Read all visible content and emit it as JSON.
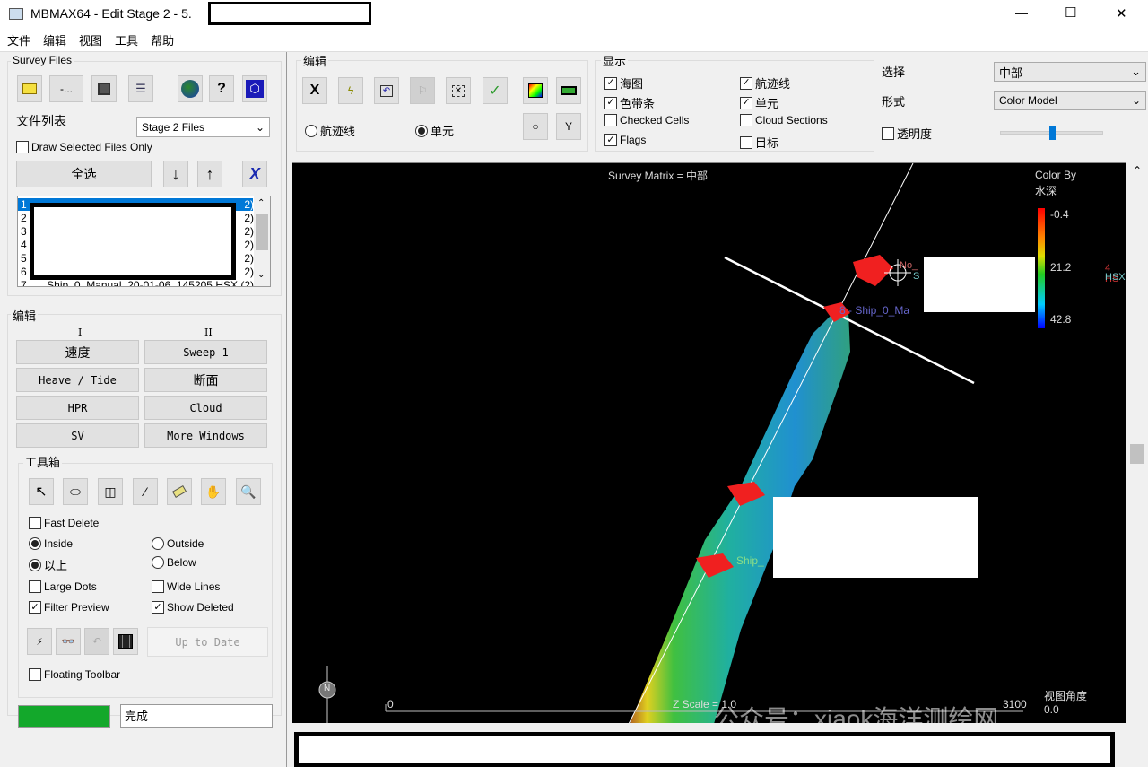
{
  "window": {
    "title": "MBMAX64 - Edit Stage 2 - 5.",
    "minimize": "—",
    "maximize": "☐",
    "close": "✕"
  },
  "menu": [
    "文件",
    "编辑",
    "视图",
    "工具",
    "帮助"
  ],
  "survey_files": {
    "label": "Survey Files",
    "list_label": "文件列表",
    "list_select": "Stage 2 Files",
    "draw_selected": "Draw Selected Files Only",
    "select_all": "全选",
    "files": [
      {
        "num": "1",
        "suffix": "2)"
      },
      {
        "num": "2",
        "suffix": "2)"
      },
      {
        "num": "3",
        "suffix": "2)"
      },
      {
        "num": "4",
        "suffix": "2)"
      },
      {
        "num": "5",
        "suffix": "2)"
      },
      {
        "num": "6",
        "suffix": "2)"
      },
      {
        "num": "7",
        "suffix": "Ship_0_Manual_20-01-06_145205.HSX (2)"
      }
    ]
  },
  "edit": {
    "label": "编辑",
    "col1": "I",
    "col2": "II",
    "buttons": [
      "速度",
      "Sweep 1",
      "Heave / Tide",
      "断面",
      "HPR",
      "Cloud",
      "SV",
      "More Windows"
    ]
  },
  "toolbox": {
    "label": "工具箱",
    "fast_delete": "Fast Delete",
    "inside": "Inside",
    "outside": "Outside",
    "above": "以上",
    "below": "Below",
    "large_dots": "Large Dots",
    "wide_lines": "Wide Lines",
    "filter_preview": "Filter Preview",
    "show_deleted": "Show Deleted",
    "up_to_date": "Up to Date",
    "floating_toolbar": "Floating Toolbar"
  },
  "status": {
    "text": "完成",
    "progress_color": "#13a82b",
    "progress": 100
  },
  "edit_toolbar": {
    "label": "编辑",
    "radio_track": "航迹线",
    "radio_cell": "单元"
  },
  "display": {
    "label": "显示",
    "items": [
      {
        "label": "海图",
        "checked": true
      },
      {
        "label": "航迹线",
        "checked": true
      },
      {
        "label": "色带条",
        "checked": true
      },
      {
        "label": "单元",
        "checked": true
      },
      {
        "label": "Checked Cells",
        "checked": false
      },
      {
        "label": "Cloud Sections",
        "checked": false
      },
      {
        "label": "Flags",
        "checked": true
      },
      {
        "label": "目标",
        "checked": false
      }
    ]
  },
  "select_panel": {
    "select_label": "选择",
    "select_value": "中部",
    "form_label": "形式",
    "form_value": "Color Model",
    "transparency": "透明度",
    "transparency_level": 0.5
  },
  "map": {
    "title": "Survey Matrix = 中部",
    "color_by": "Color By",
    "color_field": "水深",
    "scale_min": "-0.4",
    "scale_mid": "21.2",
    "scale_max": "42.8",
    "label_no": "No_",
    "label_s": "S",
    "label_ship8": "8 - Ship_0_Ma",
    "label_ship": "Ship_",
    "label_4hs": "4 HS",
    "label_hsx": "HSX",
    "scale_start": "0",
    "scale_end": "3100",
    "z_scale": "Z Scale = 1.0",
    "view_angle_label": "视图角度",
    "view_angle": "0.0",
    "north": "N",
    "watermark": "公众号：xiaok海洋测绘网"
  }
}
